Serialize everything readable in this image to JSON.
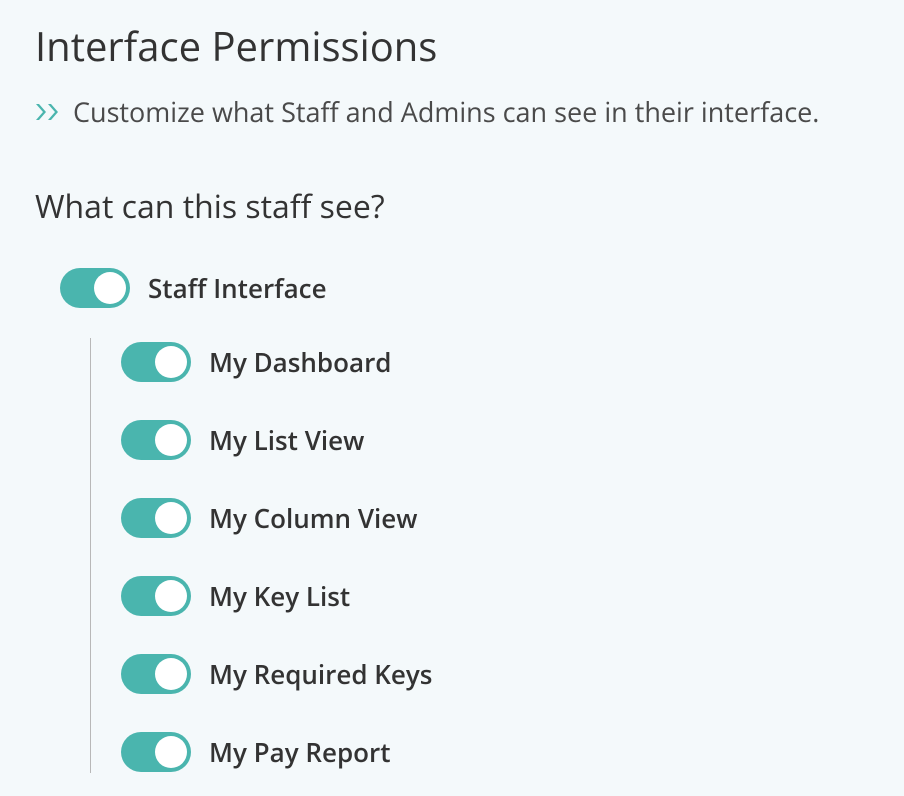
{
  "header": {
    "title": "Interface Permissions",
    "subtitle": "Customize what Staff and Admins can see in their interface."
  },
  "section": {
    "heading": "What can this staff see?",
    "main_toggle": {
      "label": "Staff Interface",
      "on": true
    },
    "children": [
      {
        "label": "My Dashboard",
        "on": true
      },
      {
        "label": "My List View",
        "on": true
      },
      {
        "label": "My Column View",
        "on": true
      },
      {
        "label": "My Key List",
        "on": true
      },
      {
        "label": "My Required Keys",
        "on": true
      },
      {
        "label": "My Pay Report",
        "on": true
      }
    ]
  },
  "colors": {
    "accent": "#4ab5ae",
    "background": "#f4f9fb"
  }
}
